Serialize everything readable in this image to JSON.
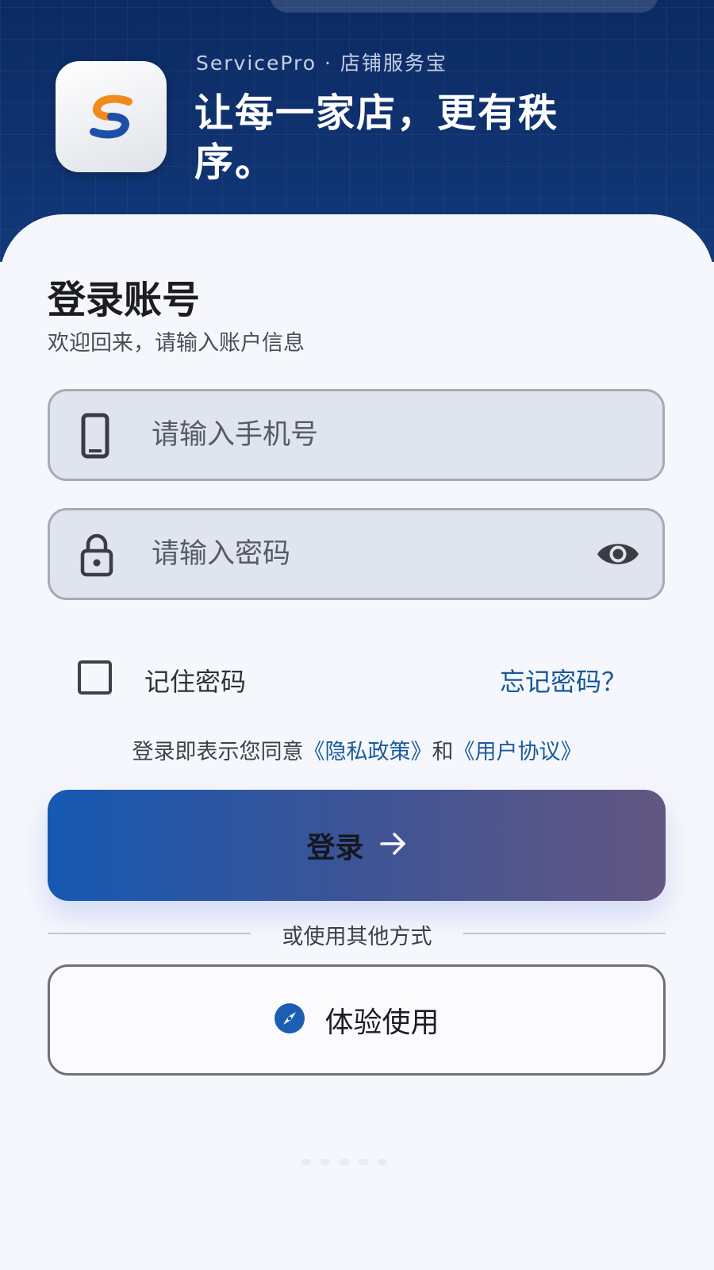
{
  "header": {
    "brand": "ServicePro · 店铺服务宝",
    "tagline": "让每一家店，更有秩序。",
    "app_icon": "servicepro-logo-icon"
  },
  "login": {
    "title": "登录账号",
    "subtitle": "欢迎回来，请输入账户信息",
    "phone_placeholder": "请输入手机号",
    "phone_icon": "smartphone-icon",
    "password_placeholder": "请输入密码",
    "password_icon": "lock-icon",
    "toggle_icon": "eye-icon",
    "remember_label": "记住密码",
    "remember_checked": false,
    "forgot_label": "忘记密码？",
    "agreement_prefix": "登录即表示您同意",
    "privacy_link": "《隐私政策》",
    "agreement_and": "和",
    "terms_link": "《用户协议》",
    "submit_label": "登录",
    "submit_icon": "arrow-right-icon",
    "divider_text": "或使用其他方式",
    "trial_label": "体验使用",
    "trial_icon": "compass-icon"
  },
  "colors": {
    "header_bg": "#0c2a63",
    "accent_link": "#14579a",
    "button_gradient_start": "#1659b3",
    "button_gradient_end": "#635782",
    "logo_orange": "#f08a1c",
    "logo_blue": "#1c4fa8"
  }
}
